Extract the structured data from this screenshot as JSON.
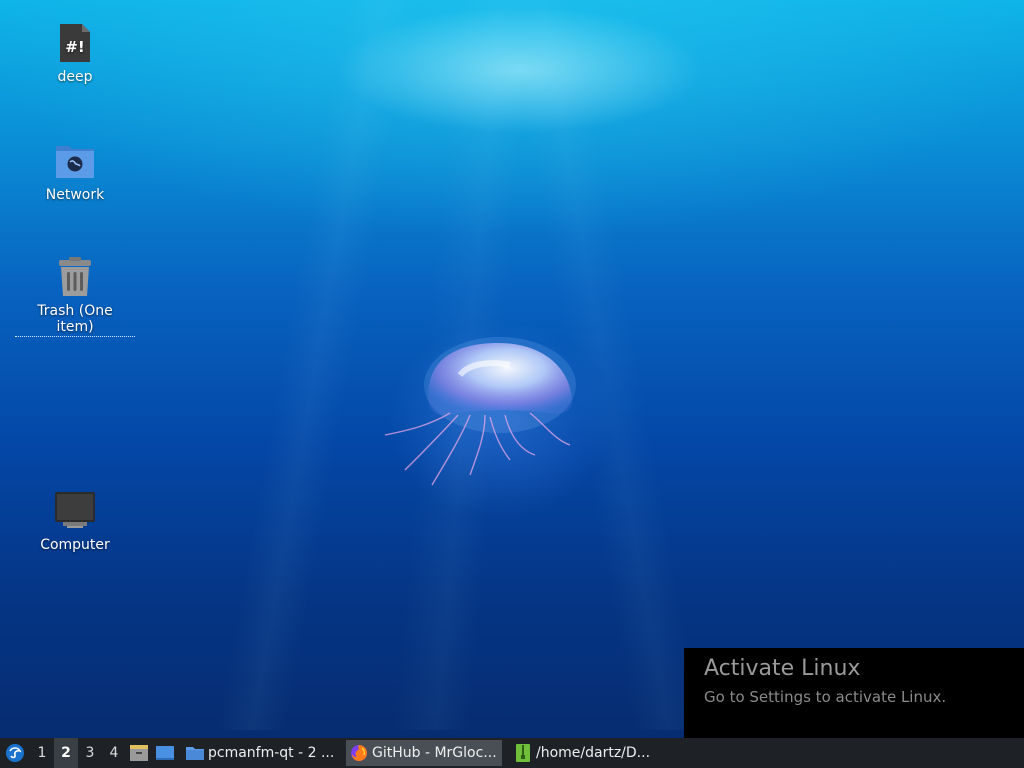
{
  "desktop": {
    "icons": [
      {
        "label": "deep",
        "icon": "shell-script-icon"
      },
      {
        "label": "Network",
        "icon": "network-folder-icon"
      },
      {
        "label": "Trash (One item)",
        "icon": "trash-icon"
      },
      {
        "label": "Computer",
        "icon": "computer-icon"
      }
    ]
  },
  "activation": {
    "title": "Activate Linux",
    "subtitle": "Go to Settings to activate Linux."
  },
  "taskbar": {
    "workspaces": [
      "1",
      "2",
      "3",
      "4"
    ],
    "active_workspace": "2",
    "tasks": [
      {
        "label": "pcmanfm-qt - 2 ...",
        "icon": "folder-icon"
      },
      {
        "label": "GitHub - MrGloc...",
        "icon": "firefox-icon"
      },
      {
        "label": "/home/dartz/D...",
        "icon": "archive-icon"
      }
    ]
  },
  "colors": {
    "taskbar_bg": "#1e2227",
    "active_task_bg": "#4a4f56",
    "water_top": "#0fb4e8",
    "water_bottom": "#062a6c"
  }
}
